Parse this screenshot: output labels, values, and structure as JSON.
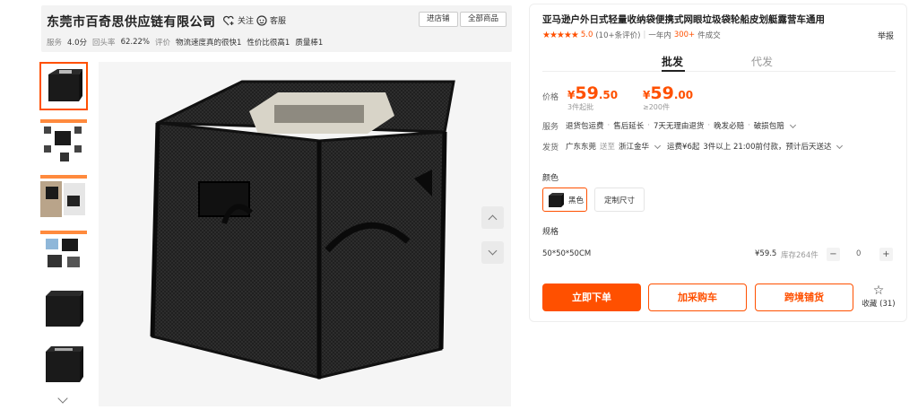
{
  "shop": {
    "name": "东莞市百奇思供应链有限公司",
    "follow_label": "关注",
    "service_label": "客服",
    "enter_shop_label": "进店铺",
    "all_products_label": "全部商品",
    "stats": {
      "service_label": "服务",
      "service_score": "4.0分",
      "repeat_label": "回头率",
      "repeat_rate": "62.22%",
      "review_label": "评价",
      "tags": [
        "物流速度真的很快1",
        "性价比很高1",
        "质量棒1"
      ]
    }
  },
  "product": {
    "title": "亚马逊户外日式轻量收纳袋便携式网眼垃圾袋轮船皮划艇露营车通用",
    "rating": {
      "stars": "★★★★★",
      "score": "5.0",
      "reviews": "(10+条评价)",
      "sold_prefix": "一年内",
      "sold_count": "300+",
      "sold_suffix": "件成交"
    },
    "report_label": "举报"
  },
  "tabs": [
    {
      "label": "批发",
      "active": true
    },
    {
      "label": "代发",
      "active": false
    }
  ],
  "pricing": {
    "label": "价格",
    "tiers": [
      {
        "currency": "¥",
        "integer": "59",
        "decimal": ".50",
        "note": "3件起批"
      },
      {
        "currency": "¥",
        "integer": "59",
        "decimal": ".00",
        "note": "≥200件"
      }
    ]
  },
  "service": {
    "label": "服务",
    "items": [
      "退货包运费",
      "售后延长",
      "7天无理由退货",
      "晚发必赔",
      "破损包赔"
    ],
    "separator": "·"
  },
  "shipping": {
    "label": "发货",
    "from": "广东东莞",
    "to_word": "送至",
    "to": "浙江金华",
    "fee": "运费¥6起",
    "note": "3件以上  21:00前付款，预计后天送达"
  },
  "color": {
    "label": "颜色",
    "options": [
      {
        "label": "黑色",
        "selected": true,
        "has_thumb": true
      },
      {
        "label": "定制尺寸",
        "selected": false,
        "has_thumb": false
      }
    ]
  },
  "spec": {
    "label": "规格",
    "rows": [
      {
        "name": "50*50*50CM",
        "price": "¥59.5",
        "stock": "库存264件",
        "qty": "0",
        "minus": "−",
        "plus": "+"
      }
    ]
  },
  "actions": {
    "buy_now": "立即下单",
    "add_cart": "加采购车",
    "cross_border": "跨境铺货",
    "favorite": "收藏 (31)",
    "favorite_icon": "☆"
  },
  "colors": {
    "accent": "#ff5000",
    "panel_bg": "#f3f3f3",
    "product_black": "#1a1a1a"
  },
  "icons": {
    "follow": "heart-plus-icon",
    "service": "headset-icon",
    "gallery_up": "chevron-up-icon",
    "gallery_down": "chevron-down-icon",
    "thumbs_more": "chevron-down-icon"
  }
}
